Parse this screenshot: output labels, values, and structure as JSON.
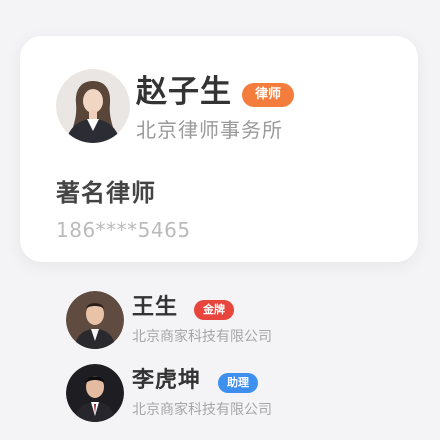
{
  "featured": {
    "name": "赵子生",
    "role_badge": "律师",
    "org": "北京律师事务所",
    "title": "著名律师",
    "phone": "186****5465"
  },
  "contacts": [
    {
      "name": "王生",
      "badge": "金牌",
      "org": "北京商家科技有限公司"
    },
    {
      "name": "李虎坤",
      "badge": "助理",
      "org": "北京商家科技有限公司"
    }
  ],
  "colors": {
    "page_bg": "#f4f4f6",
    "badge_lawyer": "#f47c3c",
    "badge_gold": "#e8453c",
    "badge_assistant": "#3d8ff0"
  },
  "icons": {
    "featured_avatar": "woman-portrait-avatar",
    "contact_avatar": "man-portrait-avatar"
  }
}
